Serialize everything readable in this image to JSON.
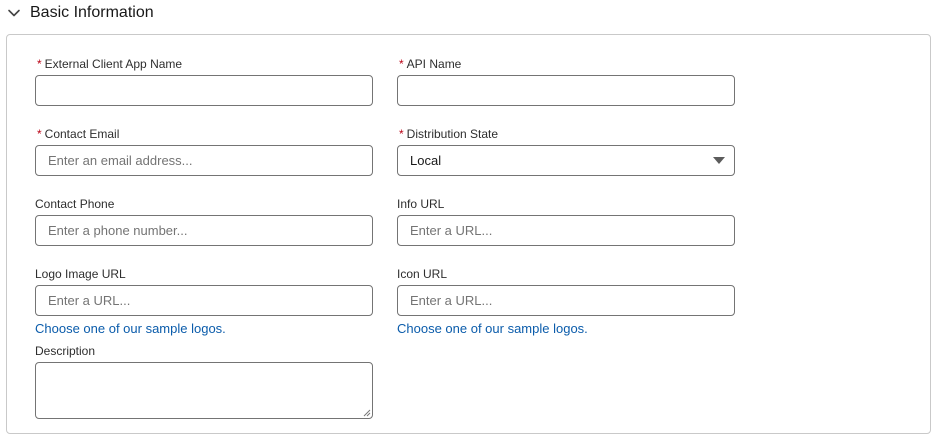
{
  "section": {
    "title": "Basic Information",
    "chevron_icon": "chevron-down-icon"
  },
  "fields": {
    "app_name": {
      "label": "External Client App Name",
      "required": "*",
      "value": "",
      "placeholder": ""
    },
    "api_name": {
      "label": "API Name",
      "required": "*",
      "value": "",
      "placeholder": ""
    },
    "contact_email": {
      "label": "Contact Email",
      "required": "*",
      "value": "",
      "placeholder": "Enter an email address..."
    },
    "distribution_state": {
      "label": "Distribution State",
      "required": "*",
      "value": "Local"
    },
    "contact_phone": {
      "label": "Contact Phone",
      "value": "",
      "placeholder": "Enter a phone number..."
    },
    "info_url": {
      "label": "Info URL",
      "value": "",
      "placeholder": "Enter a URL..."
    },
    "logo_image_url": {
      "label": "Logo Image URL",
      "value": "",
      "placeholder": "Enter a URL...",
      "help_link": "Choose one of our sample logos."
    },
    "icon_url": {
      "label": "Icon URL",
      "value": "",
      "placeholder": "Enter a URL...",
      "help_link": "Choose one of our sample logos."
    },
    "description": {
      "label": "Description",
      "value": ""
    }
  },
  "colors": {
    "required_marker": "#ba0517",
    "link": "#0b5cab",
    "border": "#747474",
    "panel_border": "#c9c9c9"
  }
}
